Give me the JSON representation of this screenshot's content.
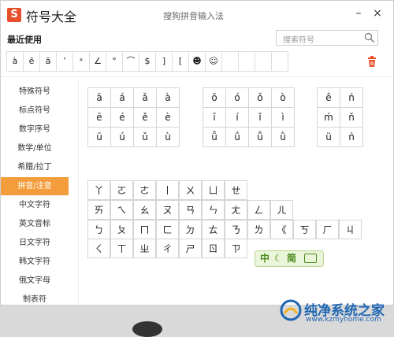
{
  "window": {
    "title": "符号大全",
    "center_title": "搜狗拼音输入法",
    "logo": "S"
  },
  "titlebar_buttons": {
    "minimize": "–",
    "close": "×"
  },
  "recent": {
    "label": "最近使用",
    "symbols": [
      "à",
      "ē",
      "ā",
      "’",
      "ˣ",
      "∠",
      "°",
      "⌒",
      "$",
      "]",
      "[",
      "☻",
      "☺",
      "",
      "",
      "",
      ""
    ]
  },
  "search": {
    "placeholder": "搜索符号"
  },
  "sidebar": {
    "items": [
      "特殊符号",
      "标点符号",
      "数字序号",
      "数学/单位",
      "希腊/拉丁",
      "拼音/注音",
      "中文字符",
      "英文音标",
      "日文字符",
      "韩文字符",
      "俄文字母",
      "制表符"
    ],
    "active_index": 5
  },
  "pinyin_a": [
    [
      "ā",
      "á",
      "ǎ",
      "à"
    ],
    [
      "ē",
      "é",
      "ě",
      "è"
    ],
    [
      "ū",
      "ú",
      "ǔ",
      "ù"
    ]
  ],
  "pinyin_o": [
    [
      "ō",
      "ó",
      "ǒ",
      "ò"
    ],
    [
      "ī",
      "í",
      "ǐ",
      "ì"
    ],
    [
      "ǖ",
      "ǘ",
      "ǚ",
      "ǜ"
    ]
  ],
  "pinyin_e": [
    [
      "ê",
      "ń"
    ],
    [
      "ḿ",
      "ň"
    ],
    [
      "ü",
      "ǹ"
    ]
  ],
  "zhuyin": [
    [
      "丫",
      "ㄛ",
      "ㄜ",
      "丨",
      "ㄨ",
      "ㄩ",
      "ㄝ",
      "",
      "",
      ""
    ],
    [
      "ㄞ",
      "ㄟ",
      "ㄠ",
      "ㄡ",
      "ㄢ",
      "ㄣ",
      "ㄤ",
      "ㄥ",
      "ㄦ",
      ""
    ],
    [
      "ㄅ",
      "ㄆ",
      "ㄇ",
      "ㄈ",
      "ㄉ",
      "ㄊ",
      "ㄋ",
      "ㄌ",
      "《",
      "ㄎ",
      "ㄏ",
      "ㄐ"
    ],
    [
      "ㄑ",
      "ㄒ",
      "ㄓ",
      "ㄔ",
      "ㄕ",
      "ㄖ",
      "ㄗ",
      "",
      "",
      "",
      "",
      ""
    ]
  ],
  "ime_badge": {
    "left": "中",
    "right": "简"
  },
  "watermark": {
    "text": "纯净系统之家",
    "url": "www.kzmyhome.com"
  },
  "colors": {
    "active_bg": "#f39c3b",
    "accent": "#e8502d",
    "watermark": "#1f66b3"
  }
}
